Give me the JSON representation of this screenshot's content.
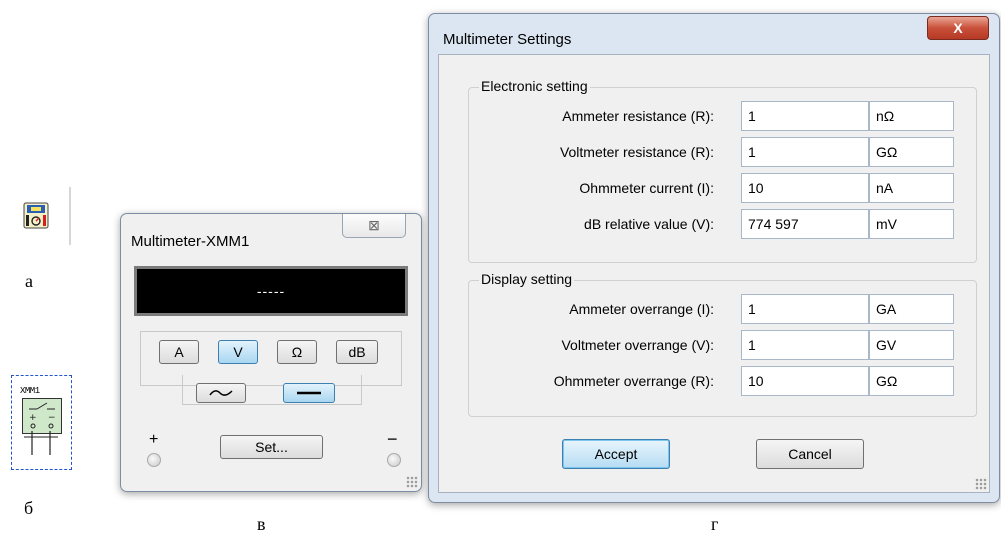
{
  "figure_labels": {
    "a": "а",
    "b": "б",
    "c": "в",
    "d": "г"
  },
  "schematic": {
    "ref": "XMM1"
  },
  "multimeter": {
    "title": "Multimeter-XMM1",
    "close": "⊠",
    "display": "-----",
    "mode_buttons": [
      {
        "label": "A",
        "active": false
      },
      {
        "label": "V",
        "active": true
      },
      {
        "label": "Ω",
        "active": false
      },
      {
        "label": "dB",
        "active": false
      }
    ],
    "signal_buttons": [
      {
        "name": "ac",
        "active": false
      },
      {
        "name": "dc",
        "active": true
      }
    ],
    "set_label": "Set...",
    "plus": "+",
    "minus": "−"
  },
  "settings": {
    "title": "Multimeter Settings",
    "close": "X",
    "electronic": {
      "title": "Electronic setting",
      "rows": [
        {
          "label": "Ammeter resistance (R):",
          "value": "1",
          "unit": "nΩ"
        },
        {
          "label": "Voltmeter resistance (R):",
          "value": "1",
          "unit": "GΩ"
        },
        {
          "label": "Ohmmeter current (I):",
          "value": "10",
          "unit": "nA"
        },
        {
          "label": "dB relative value (V):",
          "value": "774 597",
          "unit": "mV"
        }
      ]
    },
    "display": {
      "title": "Display setting",
      "rows": [
        {
          "label": "Ammeter overrange (I):",
          "value": "1",
          "unit": "GA"
        },
        {
          "label": "Voltmeter overrange (V):",
          "value": "1",
          "unit": "GV"
        },
        {
          "label": "Ohmmeter overrange (R):",
          "value": "10",
          "unit": "GΩ"
        }
      ]
    },
    "accept": "Accept",
    "cancel": "Cancel"
  }
}
